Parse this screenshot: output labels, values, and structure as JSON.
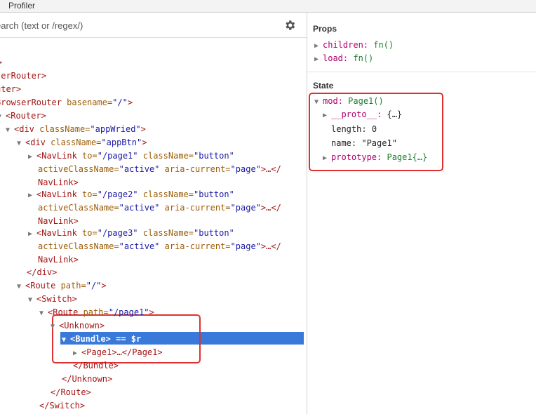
{
  "tabbar": {
    "tab_label": "Profiler"
  },
  "search": {
    "placeholder": "earch (text or /regex/)"
  },
  "tree": {
    "rows": [
      {
        "pre": ">",
        "tag": "",
        "attrs": "",
        "post": ""
      },
      {
        "pre": "",
        "tag": "serRouter",
        "attrs": "",
        "post": ">"
      },
      {
        "pre": "",
        "tag": "uter",
        "attrs": "",
        "post": ">"
      },
      {
        "pre": "",
        "tag": "BrowserRouter",
        "attrs": " basename=\"/\"",
        "post": ">"
      },
      {
        "pre": "<",
        "tag": "Router",
        "attrs": "",
        "post": ">"
      },
      {
        "pre": "<",
        "tag": "div",
        "attrs": " className=\"appWried\"",
        "post": ">"
      },
      {
        "pre": "<",
        "tag": "div",
        "attrs": " className=\"appBtn\"",
        "post": ">"
      },
      {
        "pre": "<",
        "tag": "NavLink",
        "attrs": " to=\"/page1\" className=\"button\"",
        "post": ""
      },
      {
        "pre": "",
        "tag": "",
        "attrs": "activeClassName=\"active\" aria-current=\"page\"",
        "post": ">…</"
      },
      {
        "pre": "",
        "tag": "NavLink",
        "attrs": "",
        "post": ">"
      },
      {
        "pre": "<",
        "tag": "NavLink",
        "attrs": " to=\"/page2\" className=\"button\"",
        "post": ""
      },
      {
        "pre": "",
        "tag": "",
        "attrs": "activeClassName=\"active\" aria-current=\"page\"",
        "post": ">…</"
      },
      {
        "pre": "",
        "tag": "NavLink",
        "attrs": "",
        "post": ">"
      },
      {
        "pre": "<",
        "tag": "NavLink",
        "attrs": " to=\"/page3\" className=\"button\"",
        "post": ""
      },
      {
        "pre": "",
        "tag": "",
        "attrs": "activeClassName=\"active\" aria-current=\"page\"",
        "post": ">…</"
      },
      {
        "pre": "",
        "tag": "NavLink",
        "attrs": "",
        "post": ">"
      },
      {
        "pre": "</",
        "tag": "div",
        "attrs": "",
        "post": ">"
      },
      {
        "pre": "<",
        "tag": "Route",
        "attrs": " path=\"/\"",
        "post": ">"
      },
      {
        "pre": "<",
        "tag": "Switch",
        "attrs": "",
        "post": ">"
      },
      {
        "pre": "<",
        "tag": "Route",
        "attrs": " path=\"/page1\"",
        "post": ">"
      },
      {
        "pre": "<",
        "tag": "Unknown",
        "attrs": "",
        "post": ">"
      },
      {
        "pre": "<",
        "tag": "Bundle",
        "attrs": "",
        "post": "> == $r"
      },
      {
        "pre": "<",
        "tag": "Page1",
        "attrs": "",
        "post": ">…</Page1>"
      },
      {
        "pre": "</",
        "tag": "Bundle",
        "attrs": "",
        "post": ">"
      },
      {
        "pre": "</",
        "tag": "Unknown",
        "attrs": "",
        "post": ">"
      },
      {
        "pre": "</",
        "tag": "Route",
        "attrs": "",
        "post": ">"
      },
      {
        "pre": "</",
        "tag": "Switch",
        "attrs": "",
        "post": ">"
      },
      {
        "pre": "</",
        "tag": "Route",
        "attrs": "",
        "post": ">"
      }
    ]
  },
  "props": {
    "title": "Props",
    "items": [
      {
        "key": "children",
        "sep": ": ",
        "value": "fn()"
      },
      {
        "key": "load",
        "sep": ": ",
        "value": "fn()"
      }
    ]
  },
  "state": {
    "title": "State",
    "mod": {
      "key": "mod",
      "sep": ": ",
      "value": "Page1()"
    },
    "children": [
      {
        "key": "__proto__",
        "sep": ": ",
        "value": "{…}"
      },
      {
        "key": "length",
        "sep": ": ",
        "value": "0"
      },
      {
        "key": "name",
        "sep": ": ",
        "value": "\"Page1\""
      },
      {
        "key": "prototype",
        "sep": ": ",
        "value": "Page1{…}"
      }
    ]
  },
  "colors": {
    "selected_row": "#3879d9",
    "highlight_box": "#e03030",
    "tag": "#a31515",
    "attr_name": "#9c5d07",
    "attr_value": "#1a1aa6",
    "prop_key": "#b0006b",
    "prop_fn": "#1a7f2e"
  }
}
